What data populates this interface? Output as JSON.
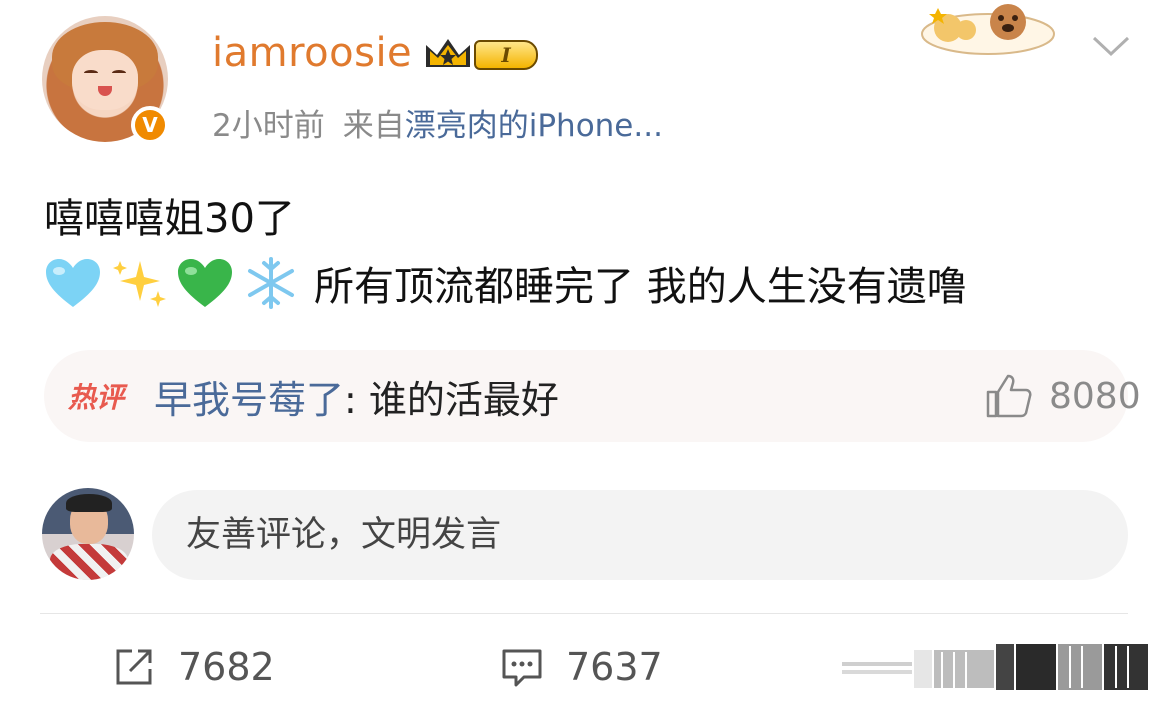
{
  "post": {
    "author": {
      "username": "iamroosie",
      "vip_level": "I",
      "verified_badge": "V"
    },
    "meta": {
      "time": "2小时前",
      "from_label": "来自",
      "source": "漂亮肉的iPhone..."
    },
    "text_line1": "嘻嘻嘻姐30了",
    "text_line2": "所有顶流都睡完了 我的人生没有遗噜",
    "emojis": [
      "light-blue-heart",
      "sparkles",
      "green-heart",
      "snowflake"
    ]
  },
  "hot_comment": {
    "tag": "热评",
    "commenter": "早我号莓了",
    "text": ": 谁的活最好",
    "likes": "8080"
  },
  "comment_box": {
    "placeholder": "友善评论，文明发言"
  },
  "actions": {
    "reposts": "7682",
    "comments": "7637"
  },
  "colors": {
    "username": "#e07a2e",
    "link": "#4a6a99",
    "hot_tag": "#e85a4f",
    "verified": "#f08a00"
  }
}
